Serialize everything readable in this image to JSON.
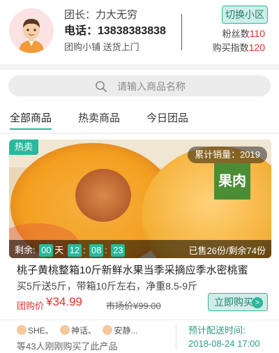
{
  "leader": {
    "name_line": "团长：力大无穷",
    "phone_line": "电话：13838383838",
    "shop_line": "团购小铺 送货上门",
    "switch_label": "切换小区",
    "fans_label": "粉丝数",
    "fans_value": "110",
    "buy_label": "购买指数",
    "buy_value": "120"
  },
  "search": {
    "placeholder": "请输入商品名称"
  },
  "tabs": [
    {
      "label": "全部商品"
    },
    {
      "label": "热卖商品"
    },
    {
      "label": "今日团品"
    }
  ],
  "product": {
    "hot_tag": "热卖",
    "sales_total": "累计销量：2019",
    "image_tag": "果肉",
    "remaining_label": "剩余:",
    "days": "00",
    "day_unit": "天",
    "hours": "12",
    "minutes": "08",
    "seconds": "23",
    "sold_info": "已售26份/剩余74份",
    "title": "桃子黄桃整箱10斤新鲜水果当季采摘应季水密桃蜜",
    "subtitle": "买5斤送5斤，带箱10斤左右，净重8.5-9斤",
    "group_price_label": "团购价",
    "group_price": "¥34.99",
    "market_price": "市场价¥99.00",
    "buy_button": "立即购买"
  },
  "footer": {
    "buyers": [
      "SHE、",
      "神话、",
      "安静..."
    ],
    "buyer_count_text": "等43人刚刚购买了此产品",
    "delivery_label": "预计配送时间:",
    "delivery_time": "2018-08-24  17:00"
  },
  "colors": {
    "accent": "#2ab89c",
    "price": "#e0302d"
  }
}
